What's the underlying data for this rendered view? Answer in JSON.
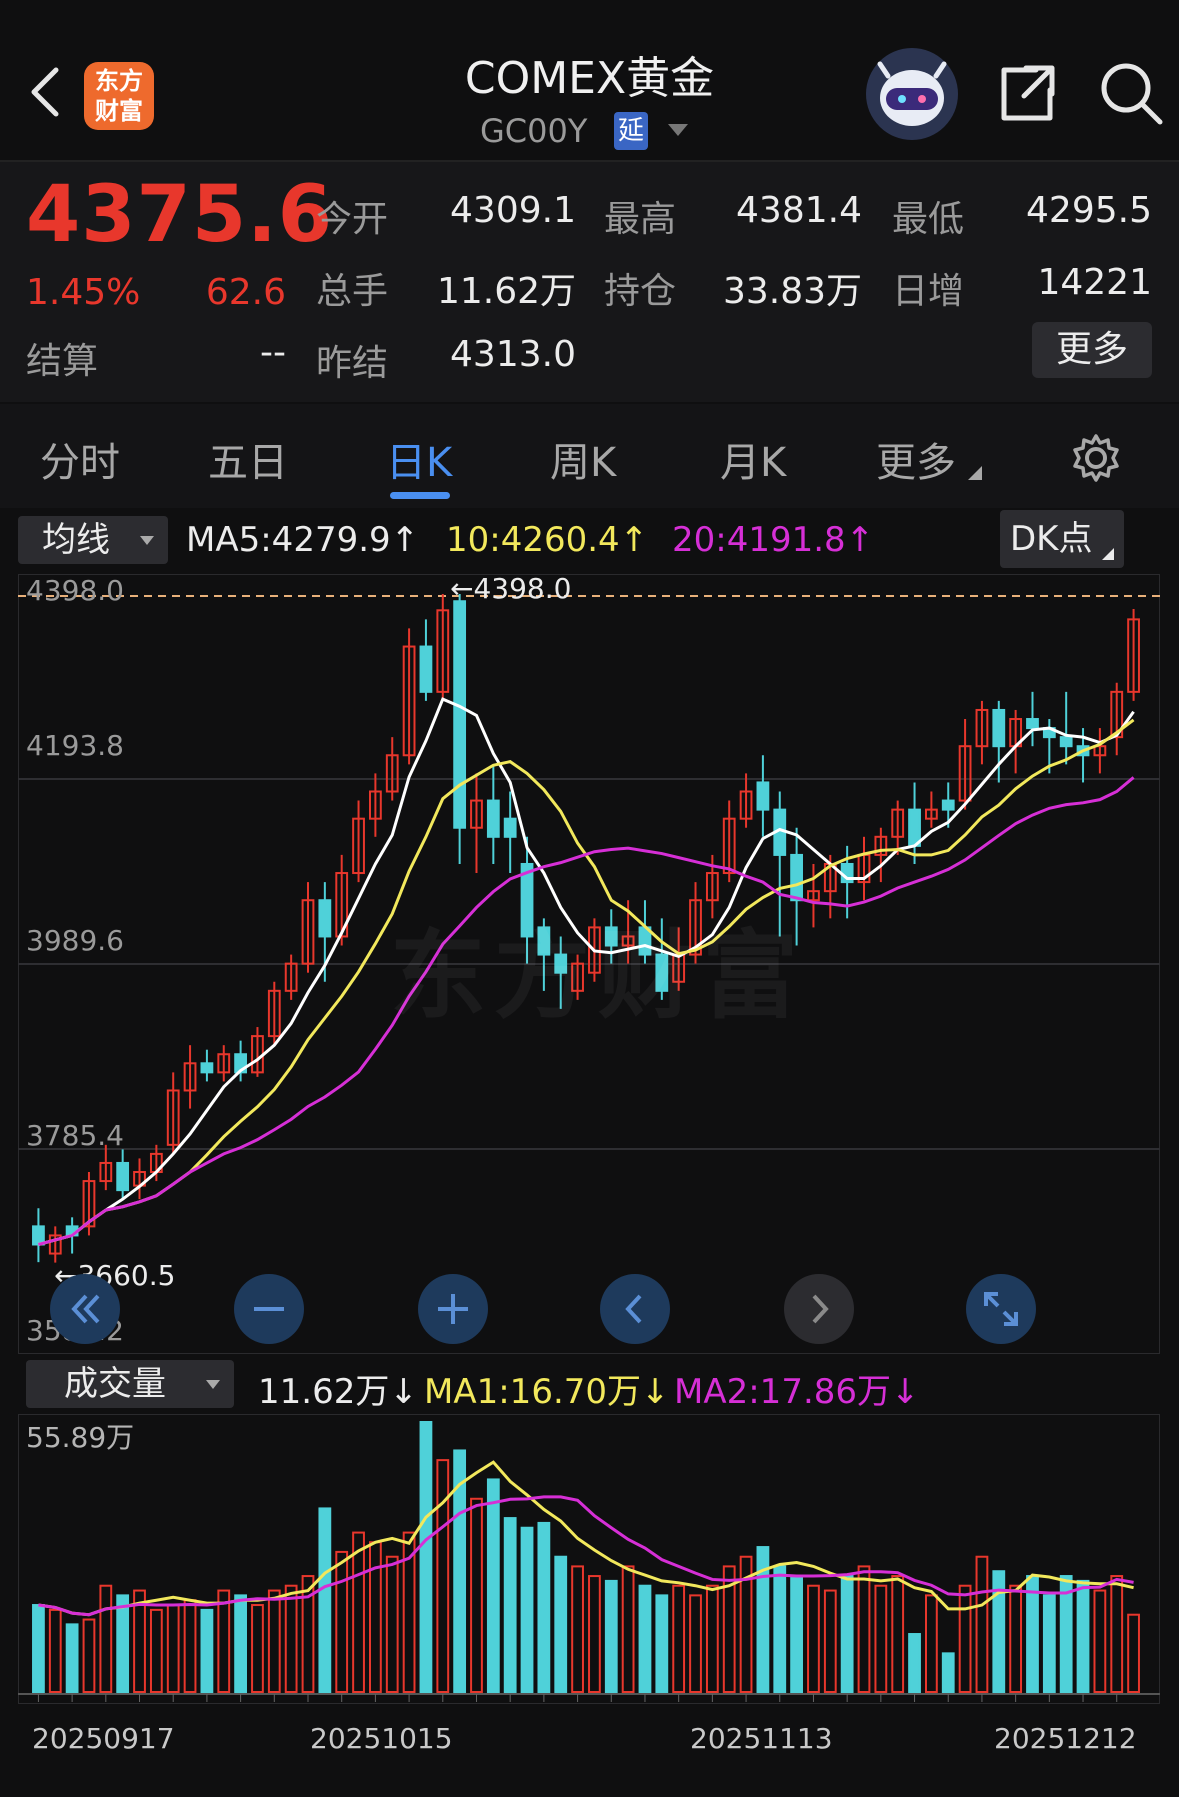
{
  "header": {
    "title": "COMEX黄金",
    "code": "GC00Y",
    "delay_badge": "延",
    "logo_text": [
      "东方",
      "财富"
    ]
  },
  "quote": {
    "price": "4375.6",
    "change_pct": "1.45%",
    "change": "62.6",
    "settle_label": "结算",
    "settle_value": "--",
    "rows": [
      [
        {
          "label": "今开",
          "value": "4309.1",
          "color": "green"
        },
        {
          "label": "最高",
          "value": "4381.4",
          "color": "red"
        },
        {
          "label": "最低",
          "value": "4295.5",
          "color": "green"
        }
      ],
      [
        {
          "label": "总手",
          "value": "11.62万",
          "color": "white"
        },
        {
          "label": "持仓",
          "value": "33.83万",
          "color": "white"
        },
        {
          "label": "日增",
          "value": "14221",
          "color": "white"
        }
      ],
      [
        {
          "label": "昨结",
          "value": "4313.0",
          "color": "white"
        }
      ]
    ],
    "more_label": "更多"
  },
  "tabs": [
    {
      "label": "分时",
      "active": false
    },
    {
      "label": "五日",
      "active": false
    },
    {
      "label": "日K",
      "active": true
    },
    {
      "label": "周K",
      "active": false
    },
    {
      "label": "月K",
      "active": false
    },
    {
      "label": "更多",
      "active": false
    }
  ],
  "main_panel": {
    "indicator_select": "均线",
    "ma5": "MA5:4279.9",
    "ma10": "10:4260.4",
    "ma20": "20:4191.8",
    "arrow_up": "↑",
    "dk_button": "DK点",
    "y_ticks": [
      "4398.0",
      "4193.8",
      "3989.6",
      "3785.4",
      "3581.2"
    ],
    "high_marker": "←4398.0",
    "low_marker": "←3660.5",
    "watermark": "东方财富",
    "colors": {
      "up": "#e8372c",
      "down": "#4fd1d9",
      "ma5": "#ffffff",
      "ma10": "#f2e85c",
      "ma20": "#d62fd6"
    }
  },
  "volume_panel": {
    "indicator_select": "成交量",
    "vol": "11.62万",
    "ma1": "MA1:16.70万",
    "ma2": "MA2:17.86万",
    "arrow_down": "↓",
    "y_max": "55.89万"
  },
  "x_labels": [
    "20250917",
    "20251015",
    "20251113",
    "20251212"
  ],
  "chart_data": {
    "type": "candlestick",
    "y_range": [
      3581.2,
      4398.0
    ],
    "volume_max_wan": 55.89,
    "candles": [
      [
        3700,
        3680,
        3720,
        3660.5,
        "d",
        18
      ],
      [
        3670,
        3690,
        3700,
        3660,
        "u",
        17
      ],
      [
        3690,
        3700,
        3710,
        3670,
        "d",
        14
      ],
      [
        3700,
        3750,
        3760,
        3690,
        "u",
        15
      ],
      [
        3750,
        3770,
        3790,
        3740,
        "u",
        22
      ],
      [
        3770,
        3740,
        3785,
        3730,
        "d",
        20
      ],
      [
        3745,
        3760,
        3775,
        3730,
        "u",
        21
      ],
      [
        3760,
        3780,
        3790,
        3750,
        "u",
        17
      ],
      [
        3790,
        3850,
        3870,
        3780,
        "u",
        18
      ],
      [
        3850,
        3880,
        3900,
        3830,
        "u",
        19
      ],
      [
        3880,
        3870,
        3895,
        3860,
        "d",
        17
      ],
      [
        3870,
        3890,
        3900,
        3860,
        "u",
        21
      ],
      [
        3890,
        3870,
        3905,
        3860,
        "d",
        20
      ],
      [
        3870,
        3910,
        3920,
        3865,
        "u",
        18
      ],
      [
        3910,
        3960,
        3970,
        3900,
        "u",
        21
      ],
      [
        3960,
        3990,
        4000,
        3950,
        "u",
        22
      ],
      [
        3990,
        4060,
        4080,
        3980,
        "u",
        24
      ],
      [
        4060,
        4020,
        4080,
        3970,
        "d",
        38
      ],
      [
        4020,
        4090,
        4110,
        4010,
        "u",
        29
      ],
      [
        4090,
        4150,
        4170,
        4080,
        "u",
        33
      ],
      [
        4150,
        4180,
        4200,
        4130,
        "u",
        31
      ],
      [
        4180,
        4220,
        4240,
        4170,
        "u",
        28
      ],
      [
        4220,
        4340,
        4360,
        4210,
        "u",
        33
      ],
      [
        4340,
        4290,
        4370,
        4280,
        "d",
        55.89
      ],
      [
        4290,
        4380,
        4398,
        4280,
        "u",
        48
      ],
      [
        4390,
        4140,
        4398,
        4100,
        "d",
        50
      ],
      [
        4140,
        4170,
        4200,
        4090,
        "u",
        40
      ],
      [
        4170,
        4130,
        4210,
        4100,
        "d",
        44
      ],
      [
        4150,
        4130,
        4180,
        4090,
        "d",
        36
      ],
      [
        4100,
        4020,
        4130,
        3990,
        "d",
        34
      ],
      [
        4030,
        4000,
        4040,
        3960,
        "d",
        35
      ],
      [
        4000,
        3980,
        4020,
        3940,
        "d",
        28
      ],
      [
        3960,
        3990,
        4000,
        3950,
        "u",
        26
      ],
      [
        3980,
        4030,
        4040,
        3970,
        "u",
        24
      ],
      [
        4030,
        4010,
        4050,
        3990,
        "d",
        23
      ],
      [
        4010,
        4020,
        4060,
        3990,
        "u",
        26
      ],
      [
        4030,
        4000,
        4060,
        3990,
        "d",
        22
      ],
      [
        4000,
        3960,
        4040,
        3950,
        "d",
        20
      ],
      [
        3970,
        4000,
        4030,
        3960,
        "u",
        22
      ],
      [
        4000,
        4060,
        4080,
        3990,
        "u",
        20
      ],
      [
        4060,
        4090,
        4110,
        4040,
        "u",
        22
      ],
      [
        4090,
        4150,
        4170,
        4080,
        "u",
        26
      ],
      [
        4150,
        4180,
        4200,
        4140,
        "u",
        28
      ],
      [
        4190,
        4160,
        4220,
        4130,
        "d",
        30
      ],
      [
        4160,
        4110,
        4180,
        4020,
        "d",
        26
      ],
      [
        4110,
        4060,
        4140,
        4010,
        "d",
        24
      ],
      [
        4060,
        4070,
        4100,
        4030,
        "u",
        22
      ],
      [
        4070,
        4100,
        4110,
        4040,
        "u",
        21
      ],
      [
        4100,
        4080,
        4120,
        4040,
        "d",
        24
      ],
      [
        4080,
        4110,
        4130,
        4060,
        "u",
        26
      ],
      [
        4110,
        4130,
        4140,
        4080,
        "u",
        22
      ],
      [
        4130,
        4160,
        4170,
        4110,
        "u",
        24
      ],
      [
        4160,
        4120,
        4190,
        4100,
        "d",
        12
      ],
      [
        4150,
        4160,
        4180,
        4140,
        "u",
        20
      ],
      [
        4170,
        4160,
        4190,
        4140,
        "d",
        8
      ],
      [
        4170,
        4230,
        4260,
        4160,
        "u",
        22
      ],
      [
        4230,
        4270,
        4280,
        4210,
        "u",
        28
      ],
      [
        4270,
        4230,
        4280,
        4190,
        "d",
        25
      ],
      [
        4230,
        4260,
        4270,
        4200,
        "u",
        22
      ],
      [
        4260,
        4250,
        4290,
        4230,
        "d",
        24
      ],
      [
        4250,
        4240,
        4260,
        4200,
        "d",
        20
      ],
      [
        4240,
        4230,
        4290,
        4210,
        "d",
        24
      ],
      [
        4230,
        4220,
        4250,
        4190,
        "d",
        23
      ],
      [
        4220,
        4230,
        4250,
        4200,
        "u",
        21
      ],
      [
        4240,
        4290,
        4300,
        4220,
        "u",
        24
      ],
      [
        4290,
        4370,
        4381.4,
        4280,
        "u",
        16
      ]
    ]
  }
}
